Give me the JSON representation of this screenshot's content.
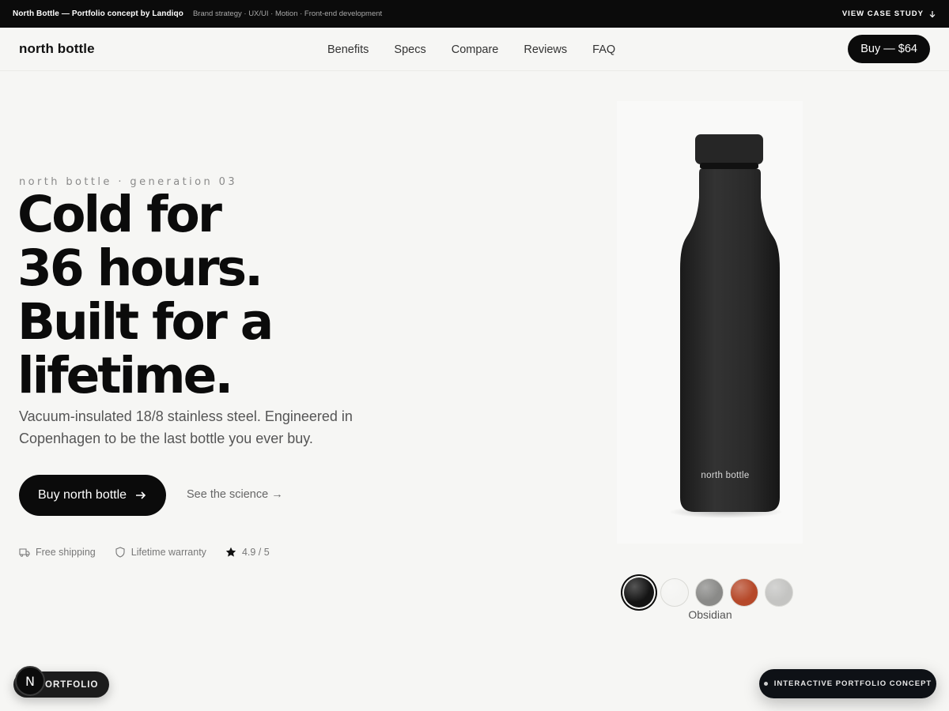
{
  "topbar": {
    "title": "North Bottle — Portfolio concept by Landiqo",
    "meta": "Brand strategy · UX/UI · Motion · Front-end development",
    "case_study": "VIEW CASE STUDY"
  },
  "nav": {
    "logo": "north bottle",
    "links": [
      "Benefits",
      "Specs",
      "Compare",
      "Reviews",
      "FAQ"
    ],
    "buy": "Buy — $64"
  },
  "hero": {
    "eyebrow": "north bottle · generation 03",
    "headline": [
      "Cold for",
      "36 hours.",
      "Built for a",
      "lifetime."
    ],
    "subtitle": "Vacuum-insulated 18/8 stainless steel. Engineered in Copenhagen to be the last bottle you ever buy.",
    "cta": "Buy north bottle",
    "secondary": "See the science →",
    "trust": [
      "Free shipping",
      "Lifetime warranty",
      "4.9 / 5"
    ]
  },
  "product": {
    "label": "north bottle",
    "selected_color": "Obsidian",
    "swatch_colors": [
      "#141414",
      "#f4f4f2",
      "#8a8a88",
      "#b6492a",
      "#c4c4c2"
    ]
  },
  "floating": {
    "portfolio_badge": "N",
    "portfolio": "ORTFOLIO",
    "concept": "INTERACTIVE PORTFOLIO CONCEPT"
  }
}
